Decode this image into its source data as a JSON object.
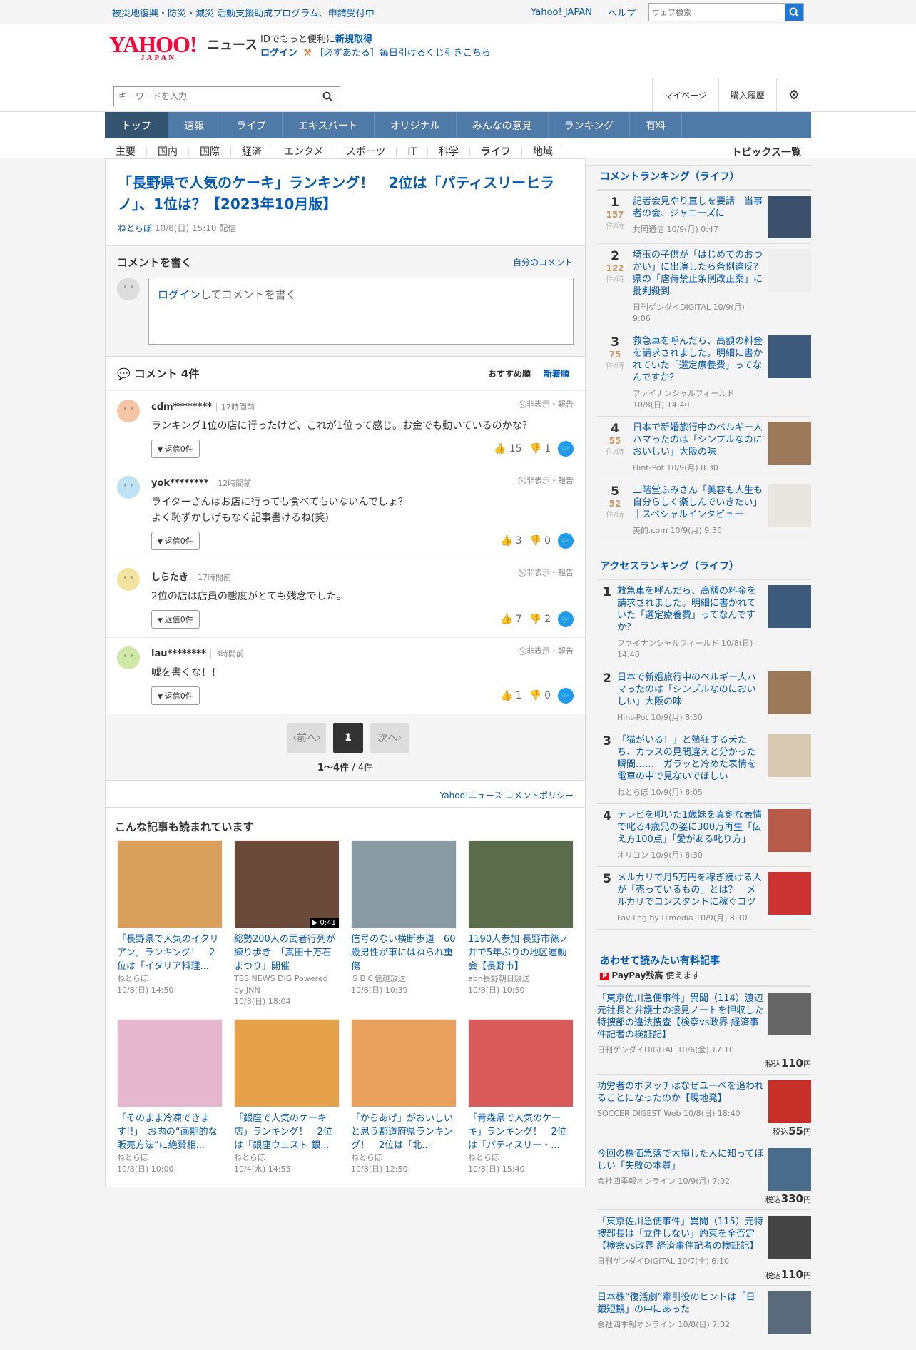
{
  "topbar": {
    "notice": "被災地復興・防災・減災 活動支援助成プログラム、申請受付中",
    "yahoo_japan": "Yahoo! JAPAN",
    "help": "ヘルプ",
    "web_search_placeholder": "ウェブ検索"
  },
  "brand": {
    "logo": "YAHOO!",
    "logo_sub": "JAPAN",
    "section": "ニュース",
    "id_msg": "IDでもっと便利に",
    "signup": "新規取得",
    "login": "ログイン",
    "lottery": "［必ずあたる］毎日引けるくじ引きこちら"
  },
  "search": {
    "placeholder": "キーワードを入力",
    "mypage": "マイページ",
    "history": "購入履歴"
  },
  "gnav": [
    "トップ",
    "速報",
    "ライブ",
    "エキスパート",
    "オリジナル",
    "みんなの意見",
    "ランキング",
    "有料"
  ],
  "snav": [
    "主要",
    "国内",
    "国際",
    "経済",
    "エンタメ",
    "スポーツ",
    "IT",
    "科学",
    "ライフ",
    "地域"
  ],
  "snav_right": "トピックス一覧",
  "article": {
    "title": "「長野県で人気のケーキ」ランキング！　2位は「パティスリーヒラノ」、1位は？【2023年10月版】",
    "source": "ねとらぼ",
    "date": "10/8(日) 15:10 配信"
  },
  "write": {
    "heading": "コメントを書く",
    "mine": "自分のコメント",
    "login": "ログイン",
    "box_text": "してコメントを書く"
  },
  "comments_head": {
    "title": "コメント 4件",
    "recommend": "おすすめ順",
    "newest": "新着順"
  },
  "comments": [
    {
      "name": "cdm********",
      "time": "17時間前",
      "text": "ランキング1位の店に行ったけど、これが1位って感じ。お金でも動いているのかな？",
      "text2": "",
      "reply": "返信0件",
      "good": "15",
      "bad": "1",
      "report": "非表示・報告",
      "color": "#f5c6a5"
    },
    {
      "name": "yok********",
      "time": "12時間前",
      "text": "ライターさんはお店に行っても食べてもいないんでしょ？",
      "text2": "よく恥ずかしげもなく記事書けるね(笑)",
      "reply": "返信0件",
      "good": "3",
      "bad": "0",
      "report": "非表示・報告",
      "color": "#bfe3f5"
    },
    {
      "name": "しらたき",
      "time": "17時間前",
      "text": "2位の店は店員の態度がとても残念でした。",
      "text2": "",
      "reply": "返信0件",
      "good": "7",
      "bad": "2",
      "report": "非表示・報告",
      "color": "#f2e2a0"
    },
    {
      "name": "lau********",
      "time": "3時間前",
      "text": "嘘を書くな！！",
      "text2": "",
      "reply": "返信0件",
      "good": "1",
      "bad": "0",
      "report": "非表示・報告",
      "color": "#cfe8a8"
    }
  ],
  "pager": {
    "prev": "前へ",
    "current": "1",
    "next": "次へ",
    "count": "1〜4件",
    "total": " / 4件"
  },
  "policy": "Yahoo!ニュース コメントポリシー",
  "related": {
    "heading": "こんな記事も読まれています",
    "items": [
      {
        "title": "「長野県で人気のイタリアン」ランキング！　2位は「イタリア料理...",
        "src": "ねとらぼ",
        "date": "10/8(日) 14:50",
        "bg": "#d9a05b"
      },
      {
        "title": "総勢200人の武者行列が練り歩き　「真田十万石まつり」開催",
        "src": "TBS NEWS DIG Powered by JNN",
        "date": "10/8(日) 18:04",
        "bg": "#6b4a3a",
        "badge": "▶ 0:41"
      },
      {
        "title": "信号のない横断歩道　60歳男性が車にはねられ重傷",
        "src": "ＳＢＣ信越放送",
        "date": "10/8(日) 10:39",
        "bg": "#8a9aa3"
      },
      {
        "title": "1190人参加 長野市篠ノ井で5年ぶりの地区運動会【長野市】",
        "src": "abn長野朝日放送",
        "date": "10/8(日) 10:50",
        "bg": "#5c6b4a"
      },
      {
        "title": "「そのまま冷凍できます!!」　お肉の“画期的な販売方法”に絶賛相...",
        "src": "ねとらぼ",
        "date": "10/8(日) 10:00",
        "bg": "#e6b8cf"
      },
      {
        "title": "「銀座で人気のケーキ店」ランキング！　2位は「銀座ウエスト 銀...",
        "src": "ねとらぼ",
        "date": "10/4(水) 14:55",
        "bg": "#e5a24a"
      },
      {
        "title": "「からあげ」がおいしいと思う都道府県ランキング！　2位は「北...",
        "src": "ねとらぼ",
        "date": "10/8(日) 12:50",
        "bg": "#e8a15c"
      },
      {
        "title": "「青森県で人気のケーキ」ランキング！　2位は「パティスリー・...",
        "src": "ねとらぼ",
        "date": "10/8(日) 15:40",
        "bg": "#d95a5a"
      }
    ]
  },
  "comment_ranking": {
    "heading": "コメントランキング（ライフ）",
    "unit": "件/時",
    "items": [
      {
        "rank": "1",
        "count": "157",
        "title": "記者会見やり直しを要請　当事者の会、ジャニーズに",
        "meta": "共同通信 10/9(月) 0:47",
        "bg": "#3c4f6b"
      },
      {
        "rank": "2",
        "count": "122",
        "title": "埼玉の子供が「はじめてのおつかい」に出演したら条例違反？県の「虐待禁止条例改正案」に批判殺到",
        "meta": "日刊ゲンダイDIGITAL 10/9(月) 9:06",
        "bg": "#eeeeee"
      },
      {
        "rank": "3",
        "count": "75",
        "title": "救急車を呼んだら、高額の料金を請求されました。明細に書かれていた「選定療養費」ってなんですか？",
        "meta": "ファイナンシャルフィールド 10/8(日) 14:40",
        "bg": "#3d5a7a"
      },
      {
        "rank": "4",
        "count": "55",
        "title": "日本で新婚旅行中のベルギー人ハマったのは「シンプルなのにおいしい」大阪の味",
        "meta": "Hint-Pot 10/9(月) 8:30",
        "bg": "#9a7a5a"
      },
      {
        "rank": "5",
        "count": "52",
        "title": "二階堂ふみさん「美容も人生も自分らしく楽しんでいきたい」｜スペシャルインタビュー",
        "meta": "美的.com 10/9(月) 9:30",
        "bg": "#e9e5e0"
      }
    ]
  },
  "access_ranking": {
    "heading": "アクセスランキング（ライフ）",
    "items": [
      {
        "rank": "1",
        "title": "救急車を呼んだら、高額の料金を請求されました。明細に書かれていた「選定療養費」ってなんですか？",
        "meta": "ファイナンシャルフィールド 10/8(日) 14:40",
        "bg": "#3d5a7a"
      },
      {
        "rank": "2",
        "title": "日本で新婚旅行中のベルギー人ハマったのは「シンプルなのにおいしい」大阪の味",
        "meta": "Hint-Pot 10/9(月) 8:30",
        "bg": "#9a7a5a"
      },
      {
        "rank": "3",
        "title": "「猫がいる！」と熱狂する犬たち、カラスの見間違えと分かった瞬間……　ガラッと冷めた表情を電車の中で見ないでほしい",
        "meta": "ねとらぼ 10/9(月) 8:05",
        "bg": "#d8c9b3"
      },
      {
        "rank": "4",
        "title": "テレビを叩いた1歳妹を真剣な表情で叱る4歳兄の姿に300万再生「伝え方100点」「愛がある叱り方」",
        "meta": "オリコン 10/9(月) 8:30",
        "bg": "#b85a4a"
      },
      {
        "rank": "5",
        "title": "メルカリで月5万円を稼ぎ続ける人が「売っているもの」とは？　メルカリでコンスタントに稼ぐコツ",
        "meta": "Fav-Log by ITmedia 10/9(月) 8:10",
        "bg": "#cc3333"
      }
    ]
  },
  "paid": {
    "heading": "あわせて読みたい有料記事",
    "paypay": "PayPay残高",
    "paypay_suffix": "使えます",
    "tax": "税込",
    "yen": "円",
    "items": [
      {
        "title": "「東京佐川急便事件」異聞（114）渡辺元社長と弁護士の接見ノートを押収した特捜部の違法捜査【検察vs政界 経済事件記者の検証記】",
        "meta": "日刊ゲンダイDIGITAL 10/6(金) 17:10",
        "price": "110",
        "bg": "#666666"
      },
      {
        "title": "功労者のボヌッチはなぜユーベを追われることになったのか【現地発】",
        "meta": "SOCCER DIGEST Web 10/8(日) 18:40",
        "price": "55",
        "bg": "#c8302a"
      },
      {
        "title": "今回の株価急落で大損した人に知ってほしい「失敗の本質」",
        "meta": "会社四季報オンライン 10/9(月) 7:02",
        "price": "330",
        "bg": "#4a6b8a"
      },
      {
        "title": "「東京佐川急便事件」異聞（115）元特捜部長は「立件しない」約束を全否定【検察vs政界 経済事件記者の検証記】",
        "meta": "日刊ゲンダイDIGITAL 10/7(土) 6:10",
        "price": "110",
        "bg": "#444444"
      },
      {
        "title": "日本株“復活劇”牽引役のヒントは「日銀短観」の中にあった",
        "meta": "会社四季報オンライン 10/8(日) 7:02",
        "price": "",
        "bg": "#5a6a7a"
      }
    ]
  }
}
